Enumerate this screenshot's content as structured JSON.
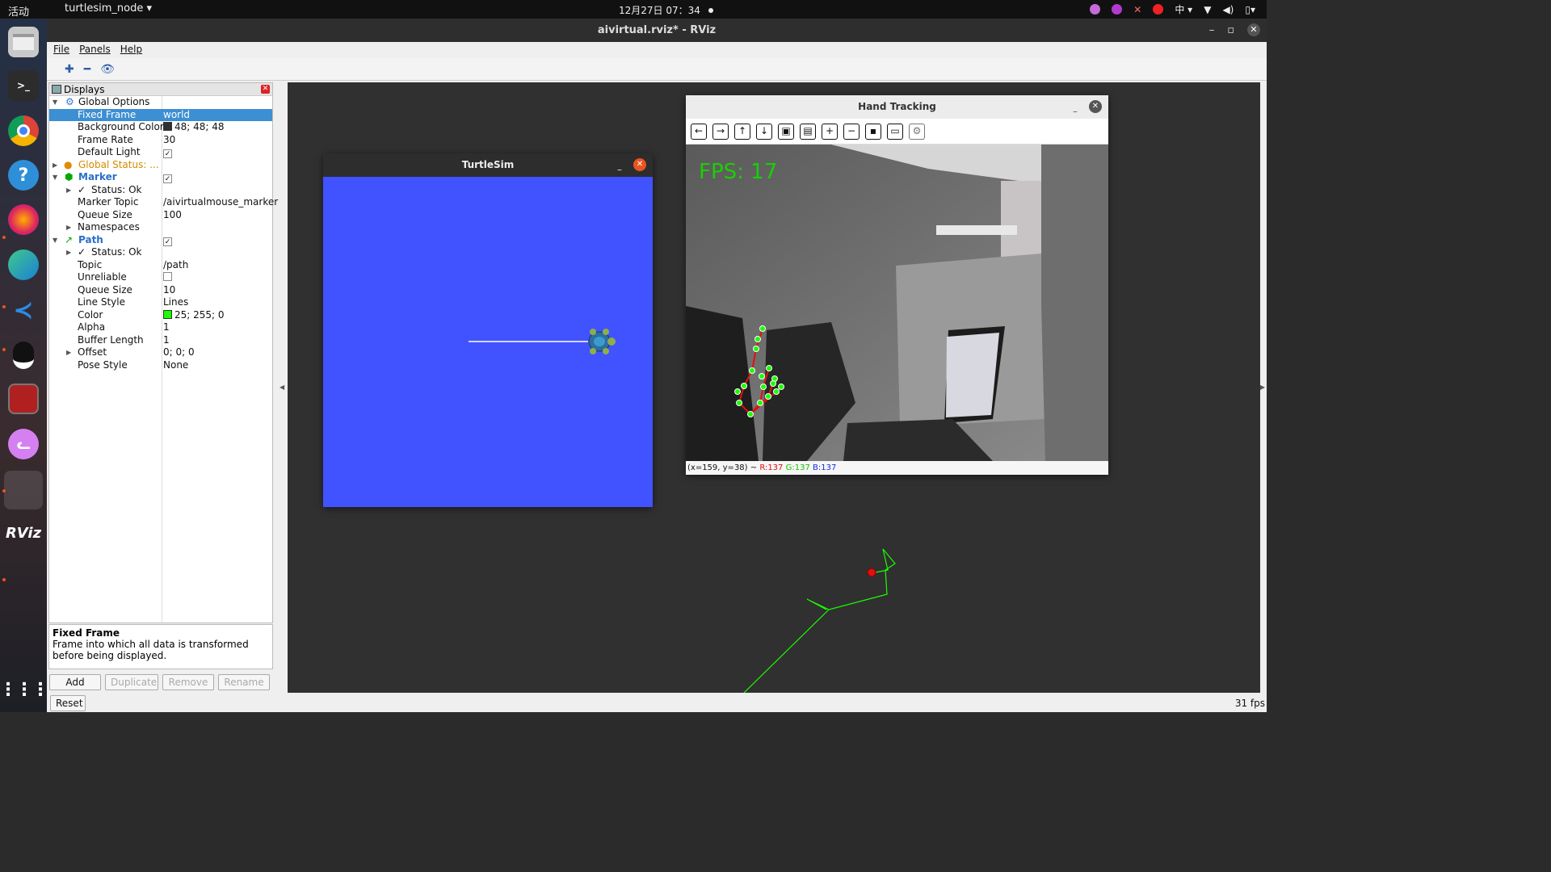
{
  "topbar": {
    "activities": "活动",
    "app_menu": "turtlesim_node ▾",
    "clock": "12月27日  07：34",
    "input_method": "中 ▾"
  },
  "dock": {
    "items": [
      "files-icon",
      "terminal-icon",
      "chrome-icon",
      "help-icon",
      "firefox-icon",
      "edge-icon",
      "vscode-icon",
      "qq-icon",
      "app-icon",
      "cat-icon",
      "rviz-icon",
      "grid-icon"
    ]
  },
  "window": {
    "title": "aivirtual.rviz* - RViz"
  },
  "menu": {
    "file": "File",
    "panels": "Panels",
    "help": "Help"
  },
  "displays": {
    "title": "Displays",
    "rows": [
      {
        "name": "Global Options",
        "value": ""
      },
      {
        "name": "Fixed Frame",
        "value": "world"
      },
      {
        "name": "Background Color",
        "value": "48; 48; 48"
      },
      {
        "name": "Frame Rate",
        "value": "30"
      },
      {
        "name": "Default Light",
        "value": "✓"
      },
      {
        "name": "Global Status: ...",
        "value": ""
      },
      {
        "name": "Marker",
        "value": "✓"
      },
      {
        "name": "Status: Ok",
        "value": ""
      },
      {
        "name": "Marker Topic",
        "value": "/aivirtualmouse_marker"
      },
      {
        "name": "Queue Size",
        "value": "100"
      },
      {
        "name": "Namespaces",
        "value": ""
      },
      {
        "name": "Path",
        "value": "✓"
      },
      {
        "name": "Status: Ok",
        "value": ""
      },
      {
        "name": "Topic",
        "value": "/path"
      },
      {
        "name": "Unreliable",
        "value": ""
      },
      {
        "name": "Queue Size",
        "value": "10"
      },
      {
        "name": "Line Style",
        "value": "Lines"
      },
      {
        "name": "Color",
        "value": "25; 255; 0"
      },
      {
        "name": "Alpha",
        "value": "1"
      },
      {
        "name": "Buffer Length",
        "value": "1"
      },
      {
        "name": "Offset",
        "value": "0; 0; 0"
      },
      {
        "name": "Pose Style",
        "value": "None"
      }
    ],
    "colors": {
      "background": "#303030",
      "path": "#19ff00",
      "selected": "#3c8fd2"
    }
  },
  "description": {
    "title": "Fixed Frame",
    "text": "Frame into which all data is transformed before being displayed."
  },
  "buttons": {
    "add": "Add",
    "duplicate": "Duplicate",
    "remove": "Remove",
    "rename": "Rename",
    "reset": "Reset"
  },
  "fps_label": "31 fps",
  "turtlesim": {
    "title": "TurtleSim",
    "bg": "#4152ff"
  },
  "hand": {
    "title": "Hand Tracking",
    "overlay": "FPS:  17",
    "status_prefix": "(x=159, y=38) ~",
    "r": "R:137",
    "g": "G:137",
    "b": "B:137"
  }
}
